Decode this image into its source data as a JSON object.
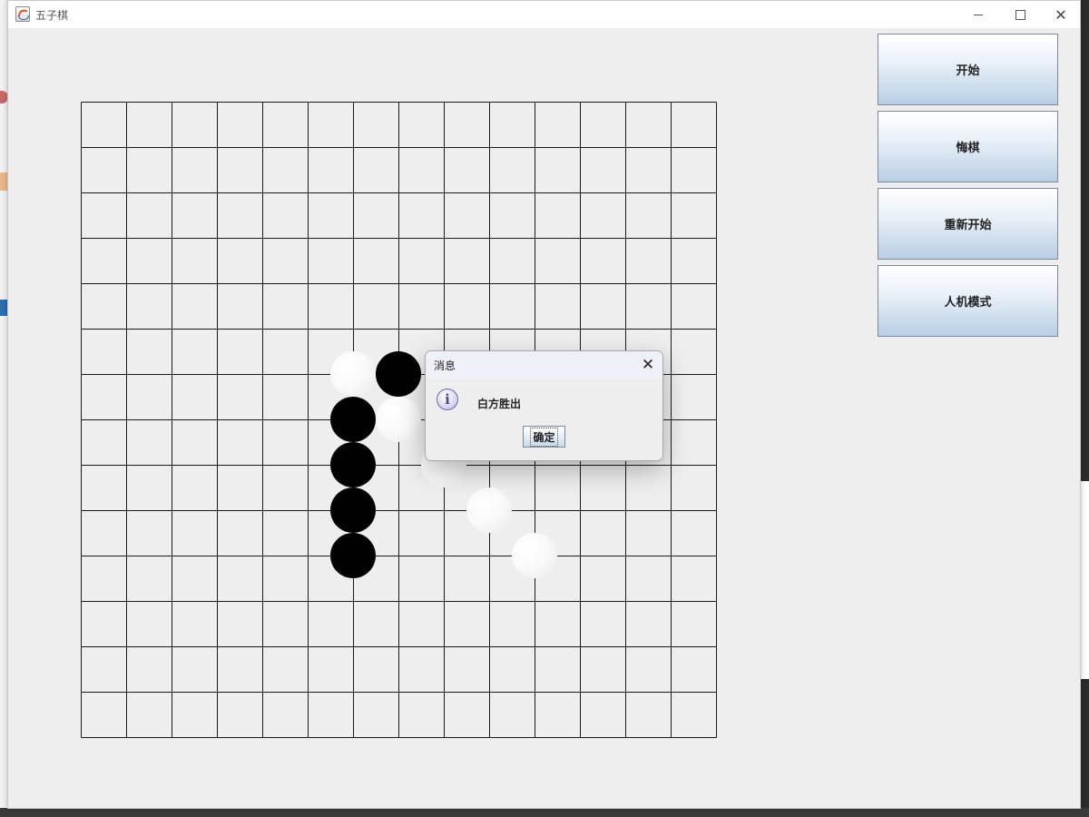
{
  "window": {
    "title": "五子棋",
    "controls": {
      "minimize": "minimize-icon",
      "maximize": "maximize-icon",
      "close": "close-icon"
    }
  },
  "board": {
    "lines": 15,
    "line_color": "#1a1a1a",
    "stones": [
      {
        "color": "white",
        "col": 6,
        "row": 6
      },
      {
        "color": "black",
        "col": 7,
        "row": 6
      },
      {
        "color": "black",
        "col": 6,
        "row": 7
      },
      {
        "color": "white",
        "col": 7,
        "row": 7
      },
      {
        "color": "black",
        "col": 6,
        "row": 8
      },
      {
        "color": "white",
        "col": 8,
        "row": 8
      },
      {
        "color": "black",
        "col": 6,
        "row": 9
      },
      {
        "color": "white",
        "col": 9,
        "row": 9
      },
      {
        "color": "black",
        "col": 6,
        "row": 10
      },
      {
        "color": "white",
        "col": 10,
        "row": 10
      }
    ]
  },
  "sidebar": {
    "buttons": [
      {
        "label": "开始"
      },
      {
        "label": "悔棋"
      },
      {
        "label": "重新开始"
      },
      {
        "label": "人机模式"
      }
    ]
  },
  "dialog": {
    "title": "消息",
    "message": "白方胜出",
    "ok_label": "确定",
    "icon": "info-icon"
  }
}
